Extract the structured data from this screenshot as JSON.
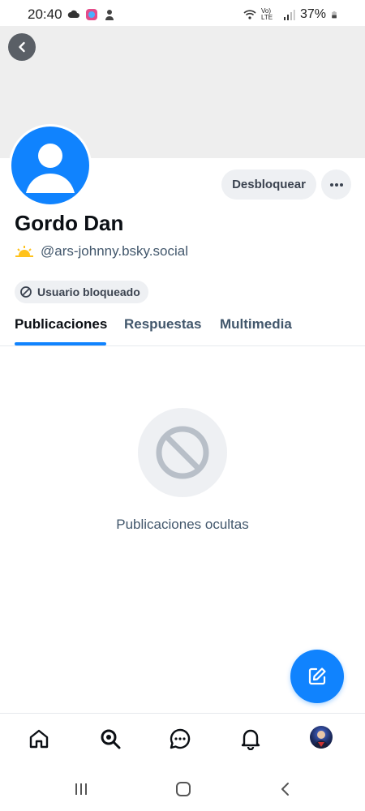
{
  "status_bar": {
    "time": "20:40",
    "lte_label": "Vo) LTE",
    "battery": "37%"
  },
  "profile": {
    "display_name": "Gordo Dan",
    "handle": "@ars-johnny.bsky.social",
    "unblock_label": "Desbloquear",
    "blocked_label": "Usuario bloqueado"
  },
  "tabs": [
    {
      "label": "Publicaciones",
      "active": true
    },
    {
      "label": "Respuestas",
      "active": false
    },
    {
      "label": "Multimedia",
      "active": false
    }
  ],
  "empty_state": {
    "message": "Publicaciones ocultas"
  },
  "bottom_nav": {
    "items": [
      "home-icon",
      "search-icon",
      "chat-icon",
      "bell-icon",
      "avatar"
    ]
  },
  "colors": {
    "accent": "#1083fe",
    "pill_bg": "#eef0f3",
    "secondary_text": "#42576c"
  }
}
